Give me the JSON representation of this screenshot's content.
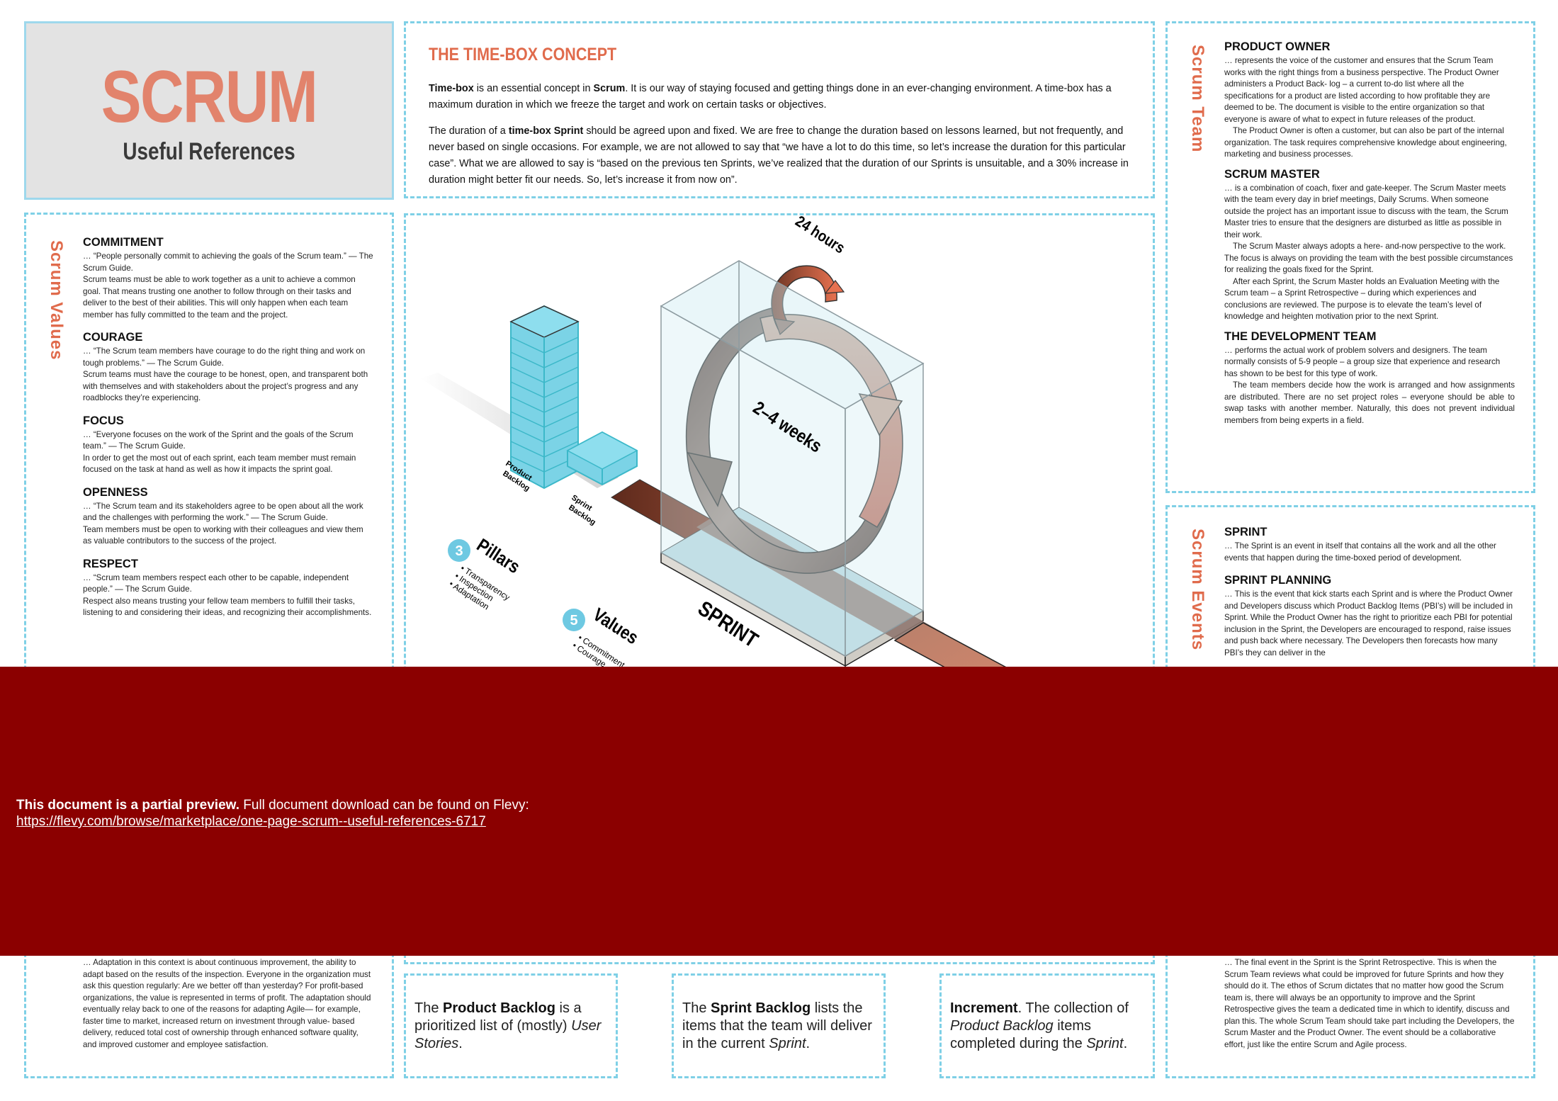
{
  "header": {
    "title": "SCRUM",
    "subtitle": "Useful References"
  },
  "timebox": {
    "title": "THE TIME-BOX CONCEPT",
    "p1": {
      "term1": "Time-box",
      "text1": " is an essential concept in ",
      "term2": "Scrum",
      "text2": ". It is our way of staying focused and getting things  done in an ever-changing environment. A time-box has a maximum duration in which we  freeze the target and work on certain tasks or objectives."
    },
    "p2": {
      "text1": "The duration of a ",
      "term": "time-box Sprint",
      "text2": " should be agreed upon and fixed. We are free to change  the duration based on lessons learned, but not frequently, and never based on single  occasions. For example, we are not allowed to say that “we have a lot to do this time, so let’s increase the duration  for this particular case”. What we are allowed to say is “based on   the previous ten Sprints, we’ve realized that the duration of our Sprints is unsuitable, and a  30% increase in duration might better fit our needs. So, let’s increase it from now on”."
    }
  },
  "values": {
    "label": "Scrum Values",
    "items": [
      {
        "heading": "COMMITMENT",
        "quote": "… “People personally commit to achieving the goals of the Scrum team.”  —  The Scrum Guide.",
        "body": "Scrum teams must be able to work together as a unit to achieve a common goal.  That means trusting one another to follow through on their tasks and deliver to the best of their abilities.  This will only happen when each team member has fully committed to the team  and the project."
      },
      {
        "heading": "COURAGE",
        "quote": "… “The Scrum team members have courage to do the right thing and work on tough problems.” — The Scrum Guide.",
        "body": "Scrum teams must have the courage to be honest, open, and transparent both with themselves and with stakeholders about the project’s progress and any roadblocks they’re experiencing."
      },
      {
        "heading": "FOCUS",
        "quote": "… “Everyone focuses on the work of the Sprint and the goals of the Scrum team.” — The Scrum Guide.",
        "body": "In order to get the most out of each sprint, each team member must remain focused on the task at hand as well as how it impacts the sprint goal."
      },
      {
        "heading": "OPENNESS",
        "quote": "… “The Scrum team and its stakeholders agree to be open about all the work and the challenges with performing the work.” — The Scrum Guide.",
        "body": "Team members must be open to working with their colleagues and view them as valuable contributors to the success of the project."
      },
      {
        "heading": "RESPECT",
        "quote": "… “Scrum team members respect each other to be capable, independent people.” — The Scrum Guide.",
        "body": "Respect also means trusting your fellow team members to fulfill their tasks, listening to and considering their ideas, and recognizing their accomplishments."
      }
    ],
    "adaptation_text": "… Adaptation in this context is about continuous improvement, the ability to adapt based on the results of the inspection. Everyone in the organization must ask this question regularly: Are we better off than yesterday? For profit-based organizations, the value is represented in terms of profit.  The adaptation should eventually relay back to one of the reasons for adapting Agile— for example, faster time to market, increased return on investment through value- based delivery, reduced total cost of ownership through enhanced software quality, and improved customer and employee satisfaction."
  },
  "team": {
    "label": "Scrum Team",
    "items": [
      {
        "heading": "PRODUCT OWNER",
        "paragraphs": [
          "… represents the voice of the customer and  ensures that the Scrum Team works with the  right things from a business perspective. The Product Owner administers a Product Back-  log – a current to-do list where all the specifications for a product are listed according to  how profitable they are deemed to be. The  document is visible to the entire organization  so that everyone is aware of what to expect in  future releases of the product.",
          "The Product Owner is often a customer,  but can also be part of the internal organization.  The task requires comprehensive knowledge about engineering, marketing and business processes."
        ]
      },
      {
        "heading": "SCRUM MASTER",
        "paragraphs": [
          "… is a combination of coach, fixer and gate-keeper. The Scrum Master meets with the  team every day in brief meetings, Daily Scrums.  When someone outside the project has an  important issue to discuss with the team, the  Scrum Master tries to ensure that the designers are disturbed as little as possible in their  work.",
          "The Scrum Master always adopts a here-  and-now perspective to the work. The focus  is always on providing the team with the best possible circumstances for realizing the goals  fixed for the Sprint.",
          "After each Sprint, the Scrum Master holds  an Evaluation Meeting with the Scrum team  – a Sprint Retrospective – during which experiences and conclusions are reviewed. The  purpose is to elevate the team’s level of knowledge and heighten motivation prior to the next Sprint."
        ]
      },
      {
        "heading": "THE DEVELOPMENT TEAM",
        "paragraphs": [
          "… performs the actual work of problem solvers and designers.  The team normally consists of 5-9 people – a group size that  experience and research has shown to be best for this type of  work.",
          "The team members decide how the work is arranged and how assignments are distributed. There are no set project roles – everyone should be able to swap tasks with another member. Naturally, this does not prevent individual members from being  experts in a field."
        ]
      }
    ]
  },
  "events": {
    "label": "Scrum Events",
    "items": [
      {
        "heading": "SPRINT",
        "body": "… The Sprint is an event in itself that contains all the work and all the other events that happen during the time-boxed period of development."
      },
      {
        "heading": "SPRINT PLANNING",
        "body": "… This is the event that kick starts each Sprint and is where the Product Owner and Developers discuss which Product Backlog Items (PBI’s) will be included in Sprint. While the Product Owner has the right to prioritize each PBI for potential inclusion in the Sprint, the Developers are encouraged to respond, raise issues and push back where necessary. The Developers then forecasts how many PBI’s they can deliver in the"
      }
    ],
    "retrospective_text": "… The final event in the Sprint is the Sprint Retrospective.  This is when the Scrum  Team reviews what could be improved for future Sprints and how they should do it. The ethos of Scrum dictates that no matter how good the Scrum team is, there will always be an opportunity to improve and the Sprint Retrospective gives the team  a dedicated time in which to identify, discuss and plan this.  The whole Scrum  Team  should take part including the Developers, the Scrum Master and the Product Owner.  The event should be a collaborative effort, just like the entire Scrum  and Agile process."
  },
  "diagram": {
    "product_backlog_label": [
      "Product",
      "Backlog"
    ],
    "sprint_backlog_label": [
      "Sprint",
      "Backlog"
    ],
    "daily_label": "24 hours",
    "sprint_length_label": "2–4 weeks",
    "sprint_label": "SPRINT",
    "pillars": {
      "number": "3",
      "title": "Pillars",
      "items": [
        "Transparency",
        "Inspection",
        "Adaptation"
      ]
    },
    "values": {
      "number": "5",
      "title": "Values",
      "items": [
        "Commitment",
        "Courage"
      ]
    }
  },
  "artifacts": [
    {
      "pre": "The ",
      "bold": "Product Backlog",
      "mid": " is a prioritized list of (mostly) ",
      "italic": "User Stories",
      "post": "."
    },
    {
      "pre": "The ",
      "bold": "Sprint Backlog",
      "mid": " lists the items that the team will deliver in the current ",
      "italic": "Sprint",
      "post": "."
    },
    {
      "pre": "",
      "bold": "Increment",
      "mid": ". The collection of ",
      "italic": "Product Backlog",
      "post": " items completed during the ",
      "italic2": "Sprint",
      "post2": "."
    }
  ],
  "preview_banner": {
    "bold": "This document is a partial preview.",
    "text": "  Full document download can be found on Flevy:",
    "link": "https://flevy.com/browse/marketplace/one-page-scrum--useful-references-6717"
  },
  "colors": {
    "accent": "#e06b4c",
    "title_accent": "#e2836c",
    "dashed_border": "#7fd0e6",
    "banner": "#8b0000",
    "backlog_cyan": "#6fd0e4"
  }
}
